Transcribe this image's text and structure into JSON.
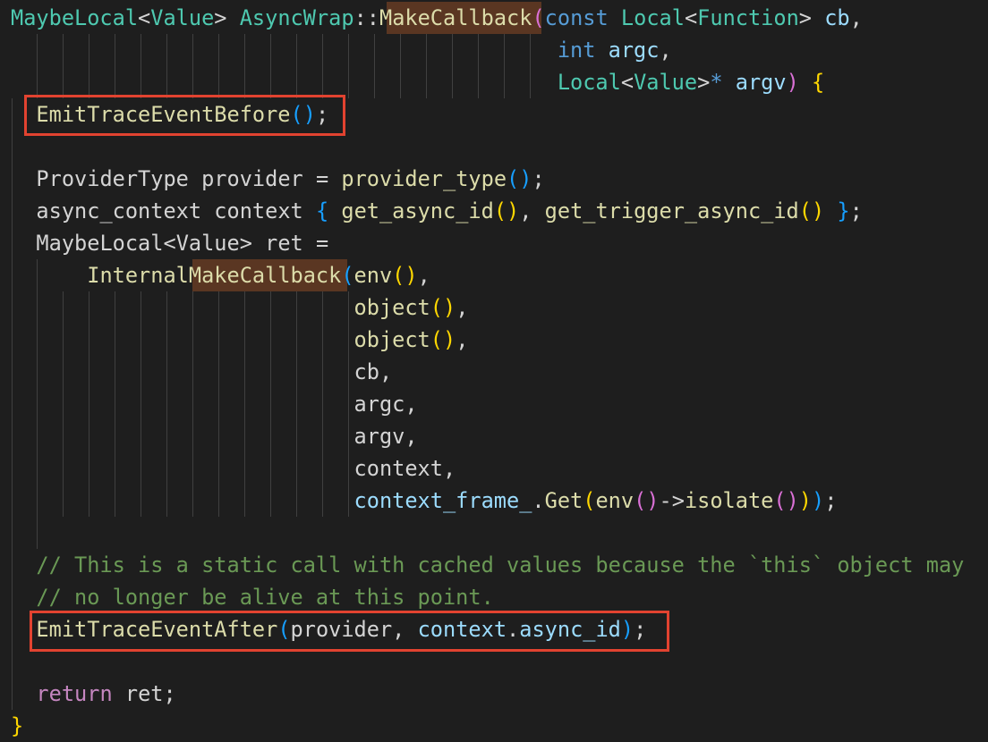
{
  "code": {
    "colors": {
      "background": "#1e1e1e",
      "type": "#4ec9b0",
      "function": "#dcdcaa",
      "keyword": "#569cd6",
      "control": "#c586c0",
      "variable": "#9cdcfe",
      "comment": "#6a9955",
      "plain": "#d4d4d4",
      "bracket_level1": "#ffd700",
      "bracket_level2": "#da70d6",
      "bracket_level3": "#179fff",
      "match_highlight": "#5a3622",
      "annotation_box": "#e24330"
    },
    "lines": [
      [
        [
          "MaybeLocal",
          "t-type"
        ],
        [
          "<",
          "t-op"
        ],
        [
          "Value",
          "t-type"
        ],
        [
          "> ",
          "t-op"
        ],
        [
          "AsyncWrap",
          "t-type"
        ],
        [
          "::",
          "t-op"
        ],
        [
          "MakeCallback",
          "t-fn"
        ],
        [
          "(",
          "b2"
        ],
        [
          "const ",
          "t-kw"
        ],
        [
          "Local",
          "t-type"
        ],
        [
          "<",
          "t-op"
        ],
        [
          "Function",
          "t-type"
        ],
        [
          "> ",
          "t-op"
        ],
        [
          "cb",
          "t-var"
        ],
        [
          ",",
          "t-pl"
        ]
      ],
      [
        [
          "                                           ",
          "t-pl"
        ],
        [
          "int ",
          "t-kw"
        ],
        [
          "argc",
          "t-var"
        ],
        [
          ",",
          "t-pl"
        ]
      ],
      [
        [
          "                                           ",
          "t-pl"
        ],
        [
          "Local",
          "t-type"
        ],
        [
          "<",
          "t-op"
        ],
        [
          "Value",
          "t-type"
        ],
        [
          ">",
          "t-op"
        ],
        [
          "* ",
          "t-kw"
        ],
        [
          "argv",
          "t-var"
        ],
        [
          ") ",
          "b2"
        ],
        [
          "{",
          "b1"
        ]
      ],
      [
        [
          "  ",
          "t-pl"
        ],
        [
          "EmitTraceEventBefore",
          "t-fn"
        ],
        [
          "()",
          "b3"
        ],
        [
          ";",
          "t-pl"
        ]
      ],
      [
        [
          "",
          "t-pl"
        ]
      ],
      [
        [
          "  ",
          "t-pl"
        ],
        [
          "ProviderType ",
          "t-pl"
        ],
        [
          "provider ",
          "t-pl"
        ],
        [
          "= ",
          "t-op"
        ],
        [
          "provider_type",
          "t-fn"
        ],
        [
          "()",
          "b3"
        ],
        [
          ";",
          "t-pl"
        ]
      ],
      [
        [
          "  ",
          "t-pl"
        ],
        [
          "async_context ",
          "t-pl"
        ],
        [
          "context ",
          "t-pl"
        ],
        [
          "{ ",
          "b3"
        ],
        [
          "get_async_id",
          "t-fn"
        ],
        [
          "()",
          "b1"
        ],
        [
          ", ",
          "t-pl"
        ],
        [
          "get_trigger_async_id",
          "t-fn"
        ],
        [
          "()",
          "b1"
        ],
        [
          " }",
          "b3"
        ],
        [
          ";",
          "t-pl"
        ]
      ],
      [
        [
          "  ",
          "t-pl"
        ],
        [
          "MaybeLocal",
          "t-pl"
        ],
        [
          "<",
          "t-op"
        ],
        [
          "Value",
          "t-pl"
        ],
        [
          "> ",
          "t-op"
        ],
        [
          "ret ",
          "t-pl"
        ],
        [
          "=",
          "t-op"
        ]
      ],
      [
        [
          "      ",
          "t-pl"
        ],
        [
          "InternalMakeCallback",
          "t-fn"
        ],
        [
          "(",
          "b3"
        ],
        [
          "env",
          "t-fn"
        ],
        [
          "()",
          "b1"
        ],
        [
          ",",
          "t-pl"
        ]
      ],
      [
        [
          "                           ",
          "t-pl"
        ],
        [
          "object",
          "t-fn"
        ],
        [
          "()",
          "b1"
        ],
        [
          ",",
          "t-pl"
        ]
      ],
      [
        [
          "                           ",
          "t-pl"
        ],
        [
          "object",
          "t-fn"
        ],
        [
          "()",
          "b1"
        ],
        [
          ",",
          "t-pl"
        ]
      ],
      [
        [
          "                           ",
          "t-pl"
        ],
        [
          "cb",
          "t-pl"
        ],
        [
          ",",
          "t-pl"
        ]
      ],
      [
        [
          "                           ",
          "t-pl"
        ],
        [
          "argc",
          "t-pl"
        ],
        [
          ",",
          "t-pl"
        ]
      ],
      [
        [
          "                           ",
          "t-pl"
        ],
        [
          "argv",
          "t-pl"
        ],
        [
          ",",
          "t-pl"
        ]
      ],
      [
        [
          "                           ",
          "t-pl"
        ],
        [
          "context",
          "t-pl"
        ],
        [
          ",",
          "t-pl"
        ]
      ],
      [
        [
          "                           ",
          "t-pl"
        ],
        [
          "context_frame_",
          "t-var"
        ],
        [
          ".",
          "t-pl"
        ],
        [
          "Get",
          "t-fn"
        ],
        [
          "(",
          "b1"
        ],
        [
          "env",
          "t-fn"
        ],
        [
          "()",
          "b2"
        ],
        [
          "->",
          "t-pl"
        ],
        [
          "isolate",
          "t-fn"
        ],
        [
          "()",
          "b2"
        ],
        [
          ")",
          "b1"
        ],
        [
          ")",
          "b3"
        ],
        [
          ";",
          "t-pl"
        ]
      ],
      [
        [
          "",
          "t-pl"
        ]
      ],
      [
        [
          "  ",
          "t-pl"
        ],
        [
          "// This is a static call with cached values because the `this` object may",
          "t-com"
        ]
      ],
      [
        [
          "  ",
          "t-pl"
        ],
        [
          "// no longer be alive at this point.",
          "t-com"
        ]
      ],
      [
        [
          "  ",
          "t-pl"
        ],
        [
          "EmitTraceEventAfter",
          "t-fn"
        ],
        [
          "(",
          "b3"
        ],
        [
          "provider",
          "t-pl"
        ],
        [
          ", ",
          "t-pl"
        ],
        [
          "context",
          "t-var"
        ],
        [
          ".",
          "t-pl"
        ],
        [
          "async_id",
          "t-var"
        ],
        [
          ")",
          "b3"
        ],
        [
          ";",
          "t-pl"
        ]
      ],
      [
        [
          "",
          "t-pl"
        ]
      ],
      [
        [
          "  ",
          "t-pl"
        ],
        [
          "return ",
          "t-ctl"
        ],
        [
          "ret",
          "t-pl"
        ],
        [
          ";",
          "t-pl"
        ]
      ],
      [
        [
          "}",
          "b1"
        ]
      ]
    ]
  }
}
